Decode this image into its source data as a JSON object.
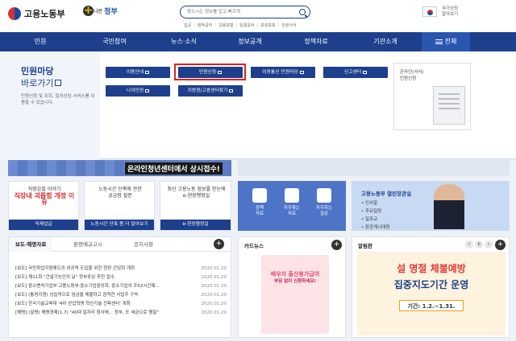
{
  "header": {
    "logo_text": "고용노동부",
    "slogan_pre": "보다 나은",
    "slogan_main": "정부",
    "search_placeholder": "찾으시는 정보를 입고 빠르게",
    "quick_links": [
      "입공",
      "회작공어",
      "고용포털",
      "일경공어",
      "모성포포",
      "민원서식"
    ],
    "country_label_1": "국가상징",
    "country_label_2": "알아보기"
  },
  "nav": {
    "items": [
      "민원",
      "국민참여",
      "뉴스·소식",
      "정보공개",
      "정책자료",
      "기관소개"
    ],
    "all_label": "전체"
  },
  "mega": {
    "title": "민원마당",
    "subtitle": "바로가기",
    "description": "민원신청 및 조회, 질의상담 서비스를 이용할 수 있습니다.",
    "buttons": [
      "이용안내",
      "민원신청",
      "이동통신 민원마당",
      "신고센터",
      "나의민원",
      "지방청/고용센터찾기"
    ],
    "right_label_1": "온라인(서식)",
    "right_label_2": "민원신청"
  },
  "background": {
    "banner_text": "온라인청년센터에서 상시접수!",
    "cards": [
      {
        "lines": [
          "직장갑질 이야기",
          "직장내 괴롭힘 개정 이유"
        ],
        "foot": "직제업급"
      },
      {
        "lines": [
          "노동시간 단축에 관한",
          "궁금점 질문"
        ],
        "foot": "노동시간 단축 좀 더 알아보기"
      },
      {
        "lines": [
          "최신 고용노동 정보를 한눈에",
          "e-현장행정일"
        ],
        "foot": "e-현장행정일"
      }
    ],
    "icon_labels": [
      "정책\n자료",
      "자주찾는\n자료",
      "자주하는\n질문"
    ],
    "pres_title": "고용노동부 열린장관실",
    "pres_list": [
      "• 인사말",
      "• 주요일정",
      "• 일과교",
      "• 장관게시대원"
    ]
  },
  "news": {
    "tabs": [
      "보도·해명자료",
      "훈령예규고시",
      "공지사항"
    ],
    "rows": [
      {
        "text": "[보도] 국민취업지원제도의 성공적 도입을 위한 현장 간담회 개최",
        "date": "2020.01.20"
      },
      {
        "text": "[보도] 제11회 \"건설기능인의 날\" 정부포상 추천 접수",
        "date": "2020.01.20"
      },
      {
        "text": "[보도] 중소벤처기업부·고용노동부·중소기업중앙회, 중소기업의 주52시간제...",
        "date": "2020.01.20"
      },
      {
        "text": "[보도] (통영지청) 상습적으로 임금을 체불하고 잠적한 사업주 구속",
        "date": "2020.01.20"
      },
      {
        "text": "[보도] 한국기술교육대 '4차 산업혁명 혁신기술 전파센터' 개최",
        "date": "2020.01.20"
      },
      {
        "text": "[해명] (설명) 해명경제(1.7) \"40대 일자리 참사에... 정부, 또 세금으로 땜질\"",
        "date": "2020.01.20"
      }
    ]
  },
  "cardnews": {
    "title": "카드뉴스",
    "headline": "배우자 출산휴가급여",
    "sub": "부담 없이 신청하세요!"
  },
  "alarm": {
    "title": "알림판",
    "line1": "설 명절 체불예방",
    "line2": "집중지도기간 운영",
    "date": "기간: 1.2.~1.31."
  }
}
